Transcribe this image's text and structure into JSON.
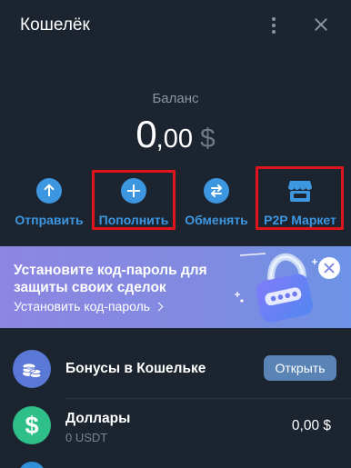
{
  "header": {
    "title": "Кошелёк",
    "menu_icon": "kebab-menu-icon",
    "close_icon": "close-icon"
  },
  "balance": {
    "label": "Баланс",
    "integer": "0",
    "decimal": ",00",
    "currency": "$"
  },
  "actions": [
    {
      "label": "Отправить",
      "icon": "arrow-up-icon",
      "highlighted": false
    },
    {
      "label": "Пополнить",
      "icon": "plus-icon",
      "highlighted": true
    },
    {
      "label": "Обменять",
      "icon": "exchange-icon",
      "highlighted": false
    },
    {
      "label": "P2P Маркет",
      "icon": "store-icon",
      "highlighted": true
    }
  ],
  "banner": {
    "title": "Установите код-пароль для защиты своих сделок",
    "link": "Установить код-пароль",
    "image": "padlock-illustration",
    "close_icon": "close-icon"
  },
  "list": {
    "bonus": {
      "title": "Бонусы в Кошельке",
      "button": "Открыть",
      "icon": "coins-icon"
    },
    "dollars": {
      "title": "Доллары",
      "subtitle": "0 USDT",
      "value": "0,00 $",
      "icon": "dollar-icon"
    }
  },
  "colors": {
    "background": "#1c2430",
    "accent": "#3d96e0",
    "highlight": "#e0151c",
    "banner": "#8189e0",
    "dollar_green": "#2fc08a",
    "bonus_avatar": "#5a78d6",
    "open_button": "#5a84b6"
  }
}
